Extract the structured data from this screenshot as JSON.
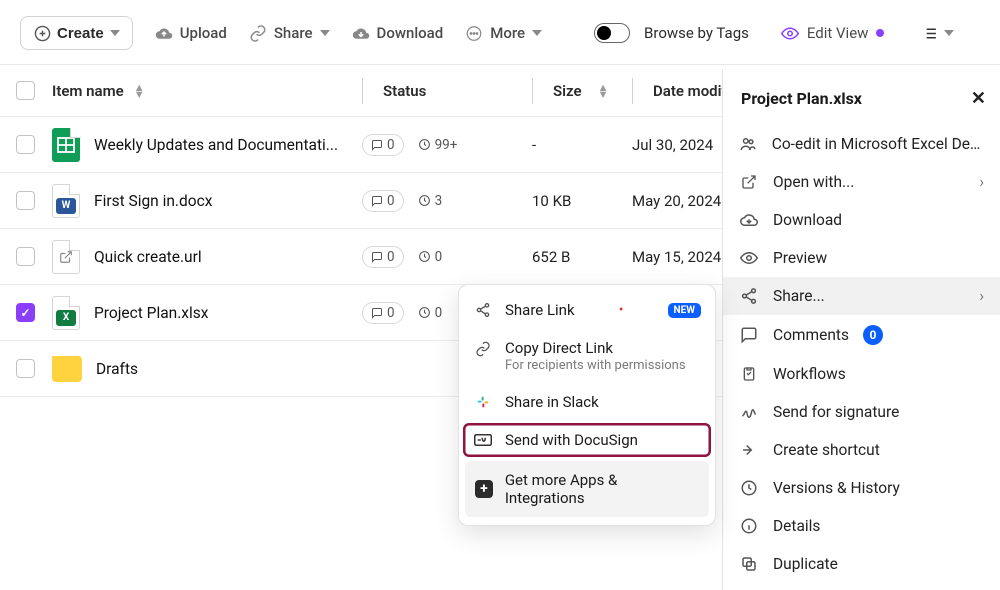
{
  "toolbar": {
    "create": "Create",
    "upload": "Upload",
    "share": "Share",
    "download": "Download",
    "more": "More",
    "browse_by_tags": "Browse by Tags",
    "edit_view": "Edit View"
  },
  "columns": {
    "name": "Item name",
    "status": "Status",
    "size": "Size",
    "date": "Date modified"
  },
  "rows": [
    {
      "selected": false,
      "icon": "sheets",
      "name": "Weekly Updates and Documentati...",
      "comments": "0",
      "versions": "99+",
      "size": "-",
      "date": "Jul 30, 2024"
    },
    {
      "selected": false,
      "icon": "word",
      "name": "First Sign in.docx",
      "comments": "0",
      "versions": "3",
      "size": "10 KB",
      "date": "May 20, 2024"
    },
    {
      "selected": false,
      "icon": "url",
      "name": "Quick create.url",
      "comments": "0",
      "versions": "0",
      "size": "652 B",
      "date": "May 15, 2024"
    },
    {
      "selected": true,
      "icon": "excel",
      "name": "Project Plan.xlsx",
      "comments": "0",
      "versions": "0",
      "size": "",
      "date": ""
    },
    {
      "selected": false,
      "icon": "folder",
      "name": "Drafts",
      "comments": "",
      "versions": "",
      "size": "",
      "date": ""
    }
  ],
  "panel": {
    "title": "Project Plan.xlsx",
    "items": {
      "coedit": "Co-edit in Microsoft Excel Desk...",
      "openwith": "Open with...",
      "download": "Download",
      "preview": "Preview",
      "share": "Share...",
      "comments": "Comments",
      "comments_count": "0",
      "workflows": "Workflows",
      "signature": "Send for signature",
      "shortcut": "Create shortcut",
      "versions": "Versions & History",
      "details": "Details",
      "duplicate": "Duplicate"
    }
  },
  "submenu": {
    "share_link": "Share Link",
    "new_badge": "NEW",
    "copy_link": "Copy Direct Link",
    "copy_link_sub": "For recipients with permissions",
    "slack": "Share in Slack",
    "docusign": "Send with DocuSign",
    "more_apps": "Get more Apps & Integrations"
  }
}
